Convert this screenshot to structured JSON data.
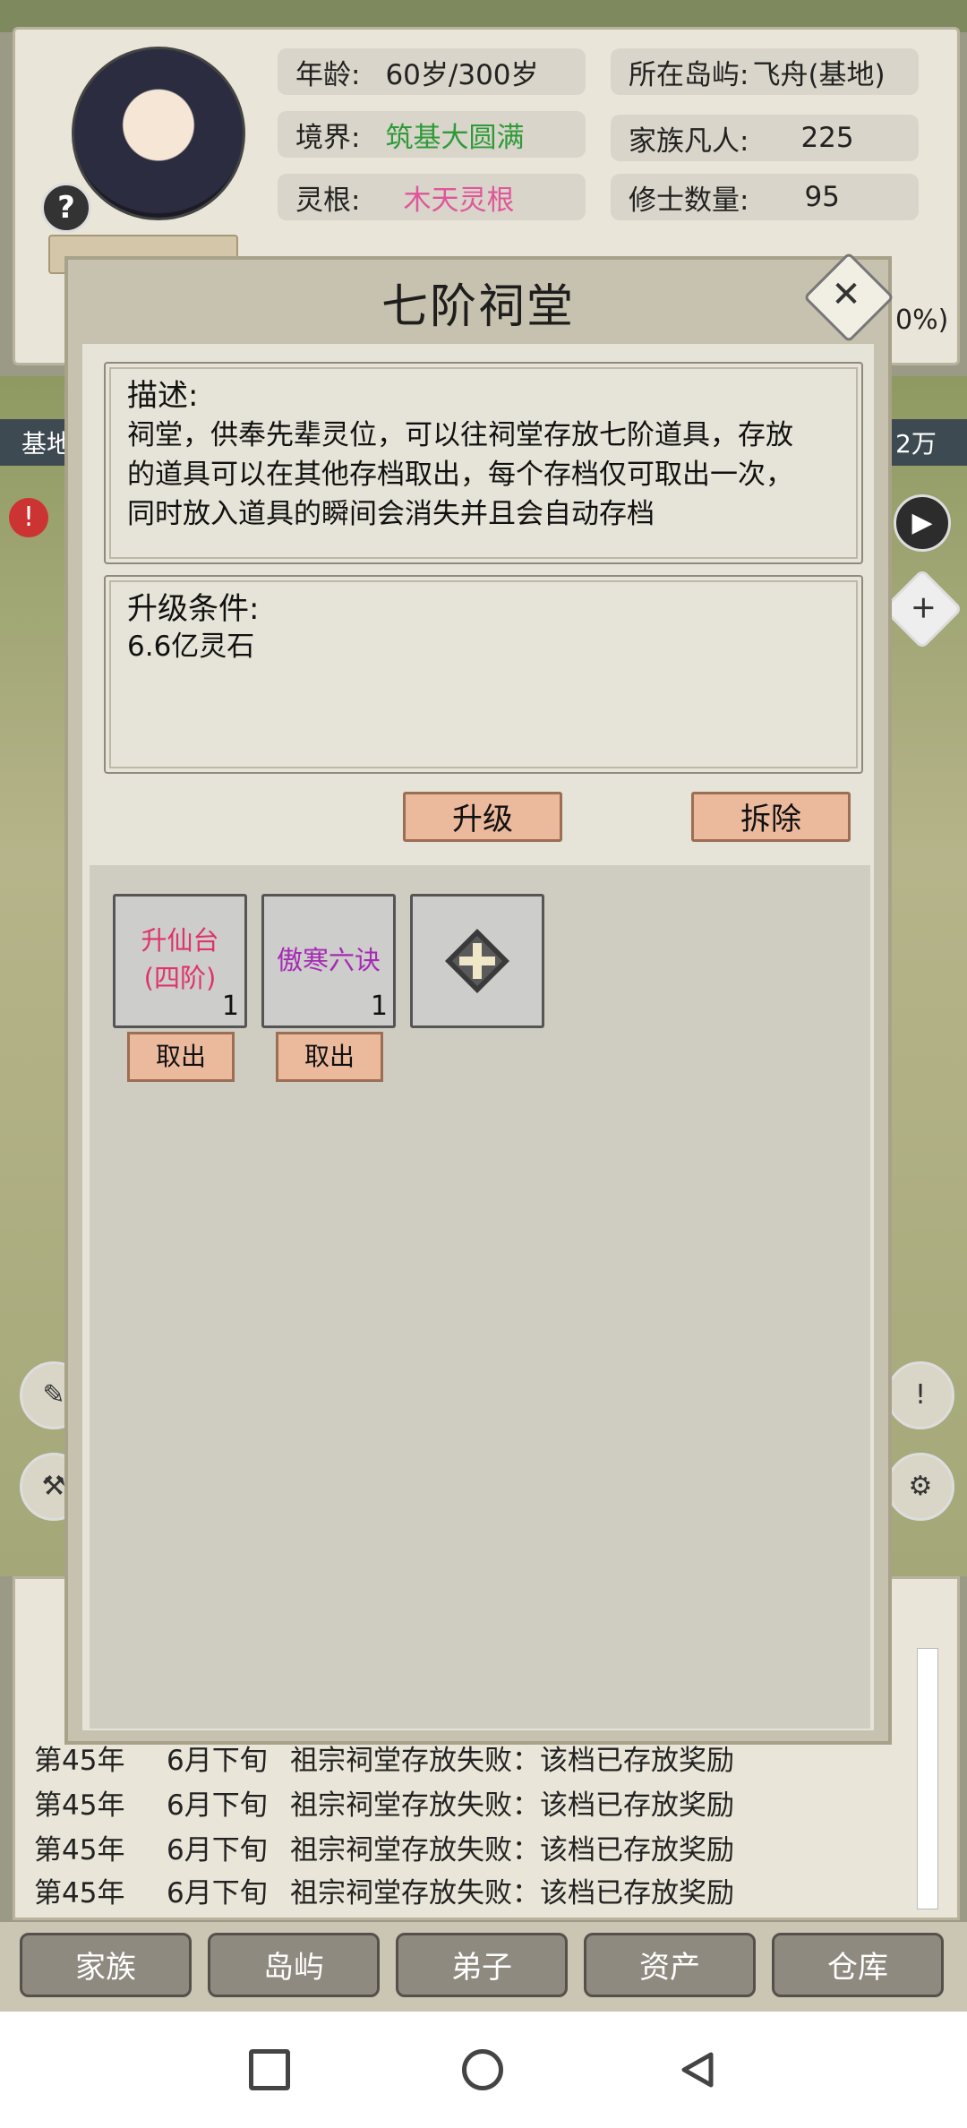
{
  "character": {
    "stats_left": [
      {
        "label": "年龄:",
        "value": "60岁/300岁",
        "color": "#222222"
      },
      {
        "label": "境界:",
        "value": "筑基大圆满",
        "color": "#2f9a3a"
      },
      {
        "label": "灵根:",
        "value": "木天灵根",
        "color": "#e0569b"
      }
    ],
    "stats_right": [
      {
        "label": "所在岛屿:",
        "value": "飞舟(基地)"
      },
      {
        "label": "家族凡人:",
        "value": "225"
      },
      {
        "label": "修士数量:",
        "value": "95"
      }
    ],
    "partial_percent": "0%)"
  },
  "map": {
    "side_left_label": "基地",
    "side_right_label": "2万"
  },
  "log": {
    "lines": [
      {
        "year": "第45年",
        "month": "6月下旬",
        "text": "祖宗祠堂存放失败：该档已存放奖励"
      },
      {
        "year": "第45年",
        "month": "6月下旬",
        "text": "祖宗祠堂存放失败：该档已存放奖励"
      },
      {
        "year": "第45年",
        "month": "6月下旬",
        "text": "祖宗祠堂存放失败：该档已存放奖励"
      },
      {
        "year": "第45年",
        "month": "6月下旬",
        "text": "祖宗祠堂存放失败：该档已存放奖励"
      }
    ]
  },
  "nav": {
    "items": [
      "家族",
      "岛屿",
      "弟子",
      "资产",
      "仓库"
    ]
  },
  "modal": {
    "title": "七阶祠堂",
    "description_title": "描述:",
    "description_lines": [
      "祠堂，供奉先辈灵位，可以往祠堂存放七阶道具，存放",
      "的道具可以在其他存档取出，每个存档仅可取出一次，",
      "同时放入道具的瞬间会消失并且会自动存档"
    ],
    "upgrade_title": "升级条件:",
    "upgrade_cost": "6.6亿灵石",
    "upgrade_button": "升级",
    "demolish_button": "拆除",
    "slots": [
      {
        "name_line1": "升仙台",
        "name_line2": "(四阶)",
        "count": "1",
        "color": "#e0326e",
        "take_label": "取出"
      },
      {
        "name_line1": "傲寒六诀",
        "name_line2": "",
        "count": "1",
        "color": "#a62bb5",
        "take_label": "取出"
      }
    ],
    "add_slot_icon": "plus-icon"
  }
}
